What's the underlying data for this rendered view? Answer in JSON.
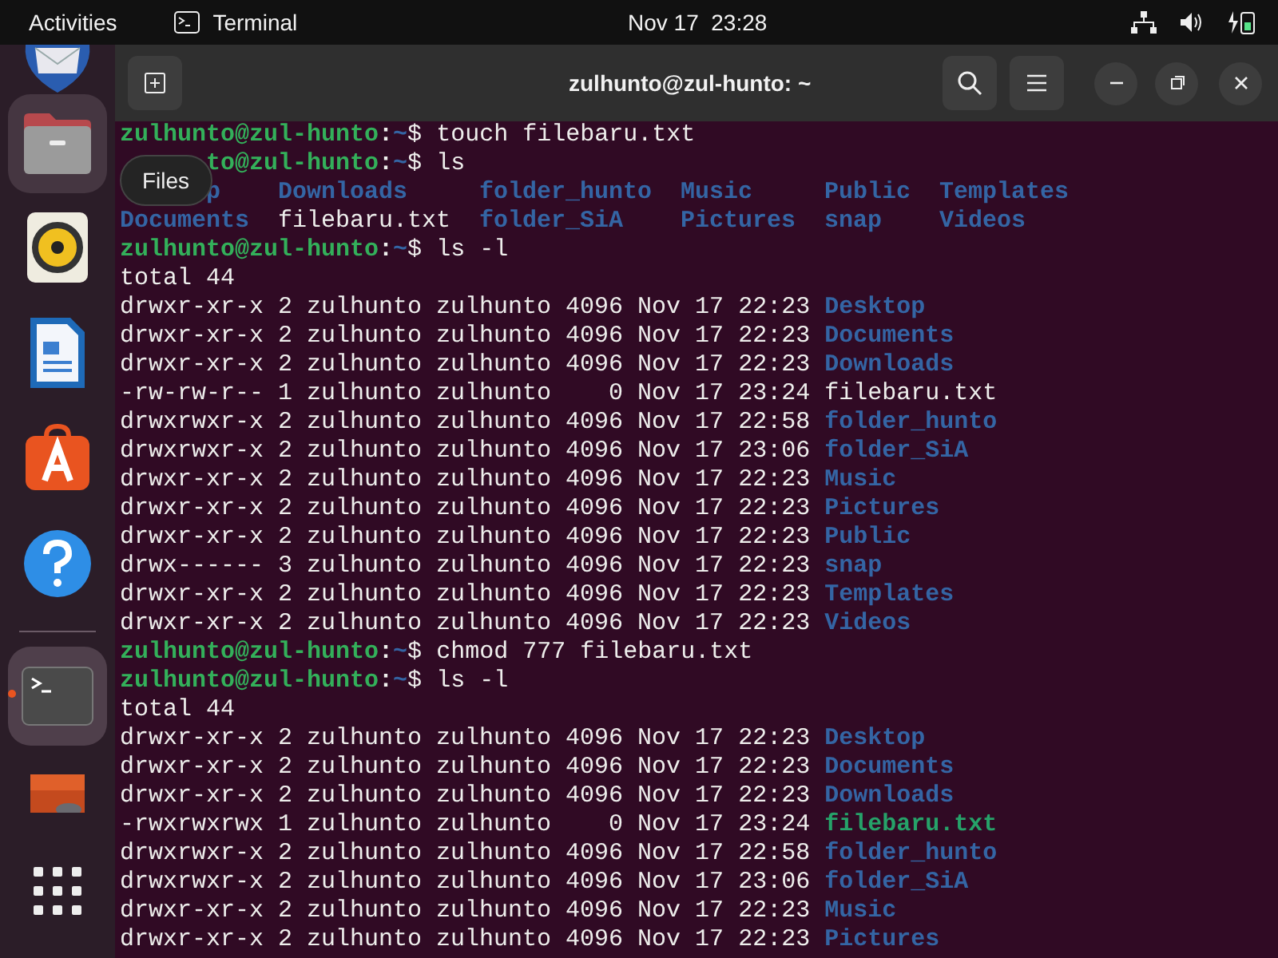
{
  "top_bar": {
    "activities": "Activities",
    "app_name": "Terminal",
    "date": "Nov 17",
    "time": "23:28"
  },
  "dock": {
    "tooltip": "Files",
    "items": [
      {
        "kind": "mail",
        "highlighted": false,
        "running": false
      },
      {
        "kind": "files",
        "highlighted": true,
        "running": false
      },
      {
        "kind": "music",
        "highlighted": false,
        "running": false
      },
      {
        "kind": "writer",
        "highlighted": false,
        "running": false
      },
      {
        "kind": "store",
        "highlighted": false,
        "running": false
      },
      {
        "kind": "help",
        "highlighted": false,
        "running": false
      },
      {
        "kind": "terminal",
        "highlighted": true,
        "running": true
      },
      {
        "kind": "media",
        "highlighted": false,
        "running": false
      },
      {
        "kind": "grid",
        "highlighted": false,
        "running": false
      }
    ]
  },
  "window": {
    "title": "zulhunto@zul-hunto: ~"
  },
  "terminal": {
    "lines": [
      {
        "kind": "prompt",
        "user": "zulhunto@zul-hunto",
        "sep": ":",
        "path": "~",
        "sigil": "$",
        "command": "touch filebaru.txt"
      },
      {
        "kind": "prompt",
        "user": "to@zul-hunto",
        "sep": ":",
        "path": "~",
        "sigil": "$",
        "command": "ls"
      },
      {
        "kind": "columns",
        "items": [
          {
            "name": "p",
            "color": "#3465a4",
            "bold": true
          },
          {
            "name": "Downloads",
            "color": "#3465a4",
            "bold": true
          },
          {
            "name": "folder_hunto",
            "color": "#3465a4",
            "bold": true
          },
          {
            "name": "Music",
            "color": "#3465a4",
            "bold": true
          },
          {
            "name": "Public",
            "color": "#3465a4",
            "bold": true
          },
          {
            "name": "Templates",
            "color": "#3465a4",
            "bold": true
          }
        ]
      },
      {
        "kind": "columns",
        "items": [
          {
            "name": "Documents",
            "color": "#3465a4",
            "bold": true
          },
          {
            "name": "filebaru.txt",
            "color": "#eeeeec",
            "bold": false
          },
          {
            "name": "folder_SiA",
            "color": "#3465a4",
            "bold": true
          },
          {
            "name": "Pictures",
            "color": "#3465a4",
            "bold": true
          },
          {
            "name": "snap",
            "color": "#3465a4",
            "bold": true
          },
          {
            "name": "Videos",
            "color": "#3465a4",
            "bold": true
          }
        ]
      },
      {
        "kind": "prompt",
        "user": "zulhunto@zul-hunto",
        "sep": ":",
        "path": "~",
        "sigil": "$",
        "command": "ls -l"
      },
      {
        "kind": "text",
        "text": "total 44"
      },
      {
        "kind": "entry",
        "meta": "drwxr-xr-x 2 zulhunto zulhunto 4096 Nov 17 22:23",
        "name": "Desktop",
        "color": "#3465a4",
        "bold": true
      },
      {
        "kind": "entry",
        "meta": "drwxr-xr-x 2 zulhunto zulhunto 4096 Nov 17 22:23",
        "name": "Documents",
        "color": "#3465a4",
        "bold": true
      },
      {
        "kind": "entry",
        "meta": "drwxr-xr-x 2 zulhunto zulhunto 4096 Nov 17 22:23",
        "name": "Downloads",
        "color": "#3465a4",
        "bold": true
      },
      {
        "kind": "entry",
        "meta": "-rw-rw-r-- 1 zulhunto zulhunto    0 Nov 17 23:24",
        "name": "filebaru.txt",
        "color": "#eeeeec",
        "bold": false
      },
      {
        "kind": "entry",
        "meta": "drwxrwxr-x 2 zulhunto zulhunto 4096 Nov 17 22:58",
        "name": "folder_hunto",
        "color": "#3465a4",
        "bold": true
      },
      {
        "kind": "entry",
        "meta": "drwxrwxr-x 2 zulhunto zulhunto 4096 Nov 17 23:06",
        "name": "folder_SiA",
        "color": "#3465a4",
        "bold": true
      },
      {
        "kind": "entry",
        "meta": "drwxr-xr-x 2 zulhunto zulhunto 4096 Nov 17 22:23",
        "name": "Music",
        "color": "#3465a4",
        "bold": true
      },
      {
        "kind": "entry",
        "meta": "drwxr-xr-x 2 zulhunto zulhunto 4096 Nov 17 22:23",
        "name": "Pictures",
        "color": "#3465a4",
        "bold": true
      },
      {
        "kind": "entry",
        "meta": "drwxr-xr-x 2 zulhunto zulhunto 4096 Nov 17 22:23",
        "name": "Public",
        "color": "#3465a4",
        "bold": true
      },
      {
        "kind": "entry",
        "meta": "drwx------ 3 zulhunto zulhunto 4096 Nov 17 22:23",
        "name": "snap",
        "color": "#3465a4",
        "bold": true
      },
      {
        "kind": "entry",
        "meta": "drwxr-xr-x 2 zulhunto zulhunto 4096 Nov 17 22:23",
        "name": "Templates",
        "color": "#3465a4",
        "bold": true
      },
      {
        "kind": "entry",
        "meta": "drwxr-xr-x 2 zulhunto zulhunto 4096 Nov 17 22:23",
        "name": "Videos",
        "color": "#3465a4",
        "bold": true
      },
      {
        "kind": "prompt",
        "user": "zulhunto@zul-hunto",
        "sep": ":",
        "path": "~",
        "sigil": "$",
        "command": "chmod 777 filebaru.txt"
      },
      {
        "kind": "prompt",
        "user": "zulhunto@zul-hunto",
        "sep": ":",
        "path": "~",
        "sigil": "$",
        "command": "ls -l"
      },
      {
        "kind": "text",
        "text": "total 44"
      },
      {
        "kind": "entry",
        "meta": "drwxr-xr-x 2 zulhunto zulhunto 4096 Nov 17 22:23",
        "name": "Desktop",
        "color": "#3465a4",
        "bold": true
      },
      {
        "kind": "entry",
        "meta": "drwxr-xr-x 2 zulhunto zulhunto 4096 Nov 17 22:23",
        "name": "Documents",
        "color": "#3465a4",
        "bold": true
      },
      {
        "kind": "entry",
        "meta": "drwxr-xr-x 2 zulhunto zulhunto 4096 Nov 17 22:23",
        "name": "Downloads",
        "color": "#3465a4",
        "bold": true
      },
      {
        "kind": "entry",
        "meta": "-rwxrwxrwx 1 zulhunto zulhunto    0 Nov 17 23:24",
        "name": "filebaru.txt",
        "color": "#26a269",
        "bold": true
      },
      {
        "kind": "entry",
        "meta": "drwxrwxr-x 2 zulhunto zulhunto 4096 Nov 17 22:58",
        "name": "folder_hunto",
        "color": "#3465a4",
        "bold": true
      },
      {
        "kind": "entry",
        "meta": "drwxrwxr-x 2 zulhunto zulhunto 4096 Nov 17 23:06",
        "name": "folder_SiA",
        "color": "#3465a4",
        "bold": true
      },
      {
        "kind": "entry",
        "meta": "drwxr-xr-x 2 zulhunto zulhunto 4096 Nov 17 22:23",
        "name": "Music",
        "color": "#3465a4",
        "bold": true
      },
      {
        "kind": "entry",
        "meta": "drwxr-xr-x 2 zulhunto zulhunto 4096 Nov 17 22:23",
        "name": "Pictures",
        "color": "#3465a4",
        "bold": true
      }
    ]
  }
}
